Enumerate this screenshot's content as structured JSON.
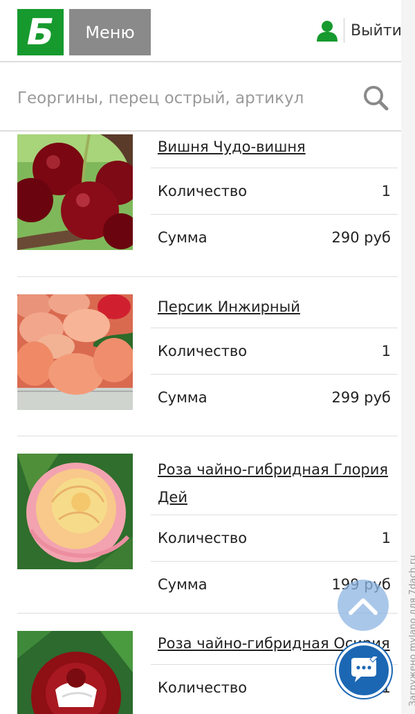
{
  "header": {
    "logo_letter": "Б",
    "menu_label": "Меню",
    "logout_label": "Выйти"
  },
  "search": {
    "placeholder": "Георгины, перец острый, артикул"
  },
  "labels": {
    "quantity": "Количество",
    "sum": "Сумма"
  },
  "items": [
    {
      "title": "Вишня Чудо-вишня",
      "quantity": "1",
      "sum": "290 руб"
    },
    {
      "title": "Персик Инжирный",
      "quantity": "1",
      "sum": "299 руб"
    },
    {
      "title": "Роза чайно-гибридная Глория Дей",
      "quantity": "1",
      "sum": "199 руб"
    },
    {
      "title": "Роза чайно-гибридная Осирия",
      "quantity": "1"
    }
  ],
  "watermark": "Загружено mylano для 7dach.ru",
  "colors": {
    "brand_green": "#169a2e",
    "menu_gray": "#8a8a8a",
    "chat_blue": "#1c67b3",
    "scroll_top_blue": "#8cb4e1"
  },
  "icons": {
    "user": "user-icon",
    "search": "search-icon",
    "scroll_top": "chevron-up-icon",
    "chat": "chat-bubble-icon"
  }
}
